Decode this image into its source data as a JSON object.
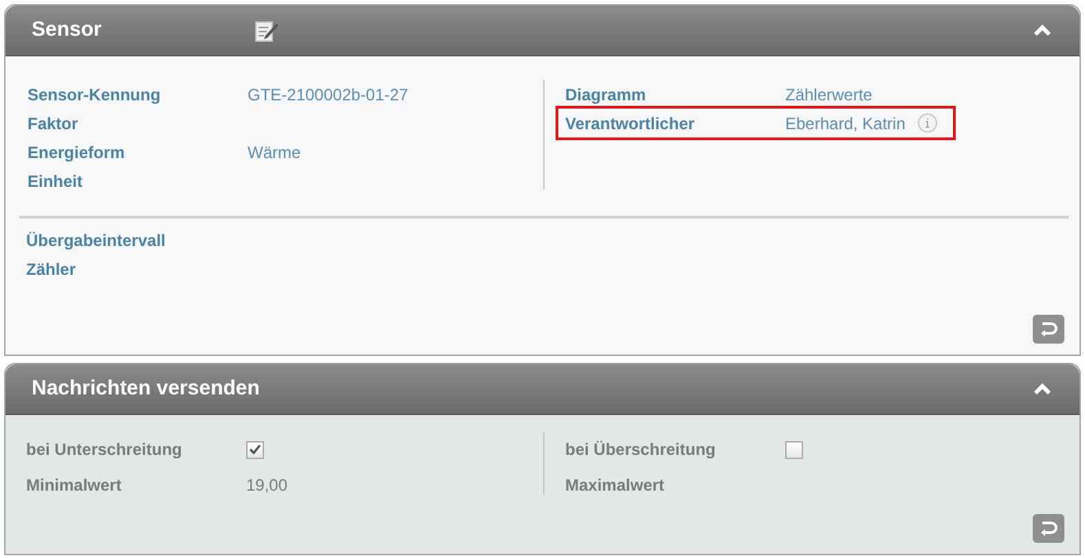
{
  "sensor_panel": {
    "title": "Sensor",
    "expanded": true,
    "left_fields": [
      {
        "label": "Sensor-Kennung",
        "value": "GTE-2100002b-01-27"
      },
      {
        "label": "Faktor"
      },
      {
        "label": "Energieform",
        "value": "Wärme"
      },
      {
        "label": "Einheit"
      }
    ],
    "right_fields": [
      {
        "label": "Diagramm",
        "value": "Zählerwerte",
        "highlighted": false,
        "info": false
      },
      {
        "label": "Verantwortlicher",
        "value": "Eberhard, Katrin",
        "highlighted": true,
        "info": true
      }
    ],
    "bottom_fields": [
      {
        "label": "Übergabeintervall"
      },
      {
        "label": "Zähler"
      }
    ]
  },
  "messages_panel": {
    "title": "Nachrichten versenden",
    "expanded": true,
    "left_fields": [
      {
        "kind": "checkbox",
        "label": "bei Unterschreitung",
        "checked": true
      },
      {
        "kind": "text",
        "label": "Minimalwert",
        "value": "19,00"
      }
    ],
    "right_fields": [
      {
        "kind": "checkbox",
        "label": "bei Überschreitung",
        "checked": false
      },
      {
        "kind": "text",
        "label": "Maximalwert"
      }
    ]
  }
}
